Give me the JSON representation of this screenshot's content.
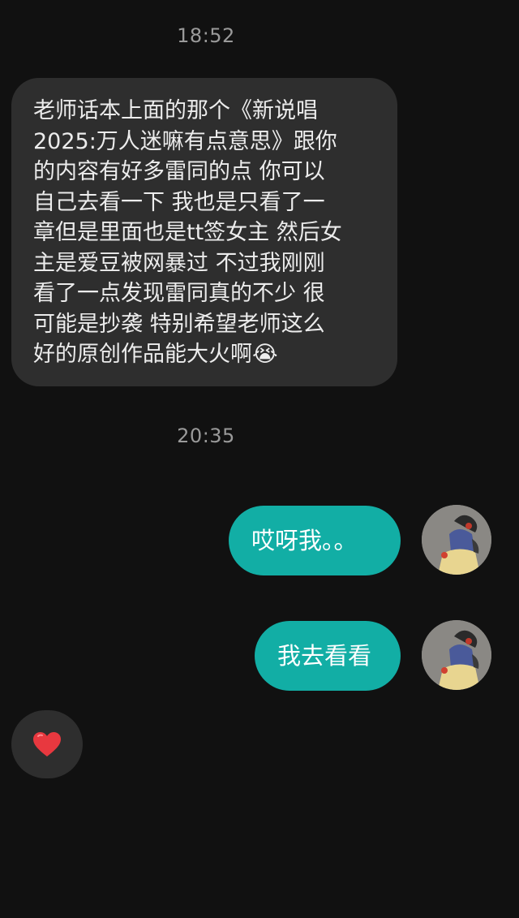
{
  "conversation": {
    "timestamps": [
      "18:52",
      "20:35"
    ],
    "incoming_message": {
      "lines": [
        "老师话本上面的那个《新说唱",
        "2025:万人迷嘛有点意思》跟你",
        "的内容有好多雷同的点 你可以",
        "自己去看一下 我也是只看了一",
        "章但是里面也是tt签女主 然后女",
        "主是爱豆被网暴过 不过我刚刚",
        "看了一点发现雷同真的不少 很",
        "可能是抄袭 特别希望老师这么",
        "好的原创作品能大火啊😭"
      ]
    },
    "outgoing_messages": [
      {
        "text": "哎呀我。。"
      },
      {
        "text": "我去看看"
      }
    ],
    "reaction": {
      "icon": "heart-icon",
      "emoji": "❤️"
    }
  },
  "colors": {
    "background": "#111111",
    "incoming_bubble": "#2e2e2e",
    "outgoing_bubble": "#12aea5",
    "timestamp_text": "#9a9a9a",
    "heart": "#e8383f"
  }
}
